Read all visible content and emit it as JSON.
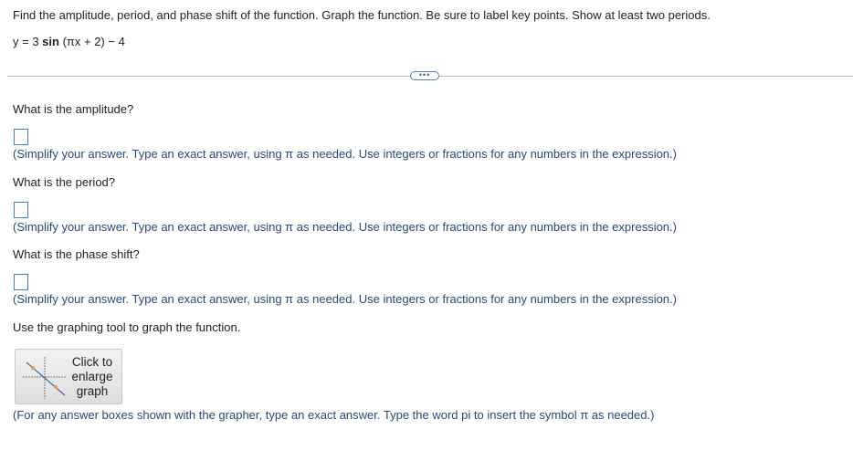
{
  "problem": {
    "instructions": "Find the amplitude, period, and phase shift of the function. Graph the function. Be sure to label key points. Show at least two periods.",
    "equation_lhs": "y = 3 ",
    "equation_func": "sin",
    "equation_rhs": " (πx + 2) − 4"
  },
  "divider": {
    "more_label": "•••"
  },
  "questions": [
    {
      "label": "What is the amplitude?",
      "answer_value": "",
      "hint": "(Simplify your answer. Type an exact answer, using π as needed. Use integers or fractions for any numbers in the expression.)"
    },
    {
      "label": "What is the period?",
      "answer_value": "",
      "hint": "(Simplify your answer. Type an exact answer, using π as needed. Use integers or fractions for any numbers in the expression.)"
    },
    {
      "label": "What is the phase shift?",
      "answer_value": "",
      "hint": "(Simplify your answer. Type an exact answer, using π as needed. Use integers or fractions for any numbers in the expression.)"
    }
  ],
  "graph_section": {
    "prompt": "Use the graphing tool to graph the function.",
    "button_label_line1": "Click to",
    "button_label_line2": "enlarge",
    "button_label_line3": "graph",
    "thumbnail_icon": "graph-thumbnail-icon",
    "footer_hint": "(For any answer boxes shown with the grapher, type an exact answer. Type the word pi to insert the symbol π as needed.)"
  },
  "colors": {
    "hint_text": "#27497a",
    "answer_box_border": "#4a7bb5",
    "graph_point": "#f0a030"
  }
}
